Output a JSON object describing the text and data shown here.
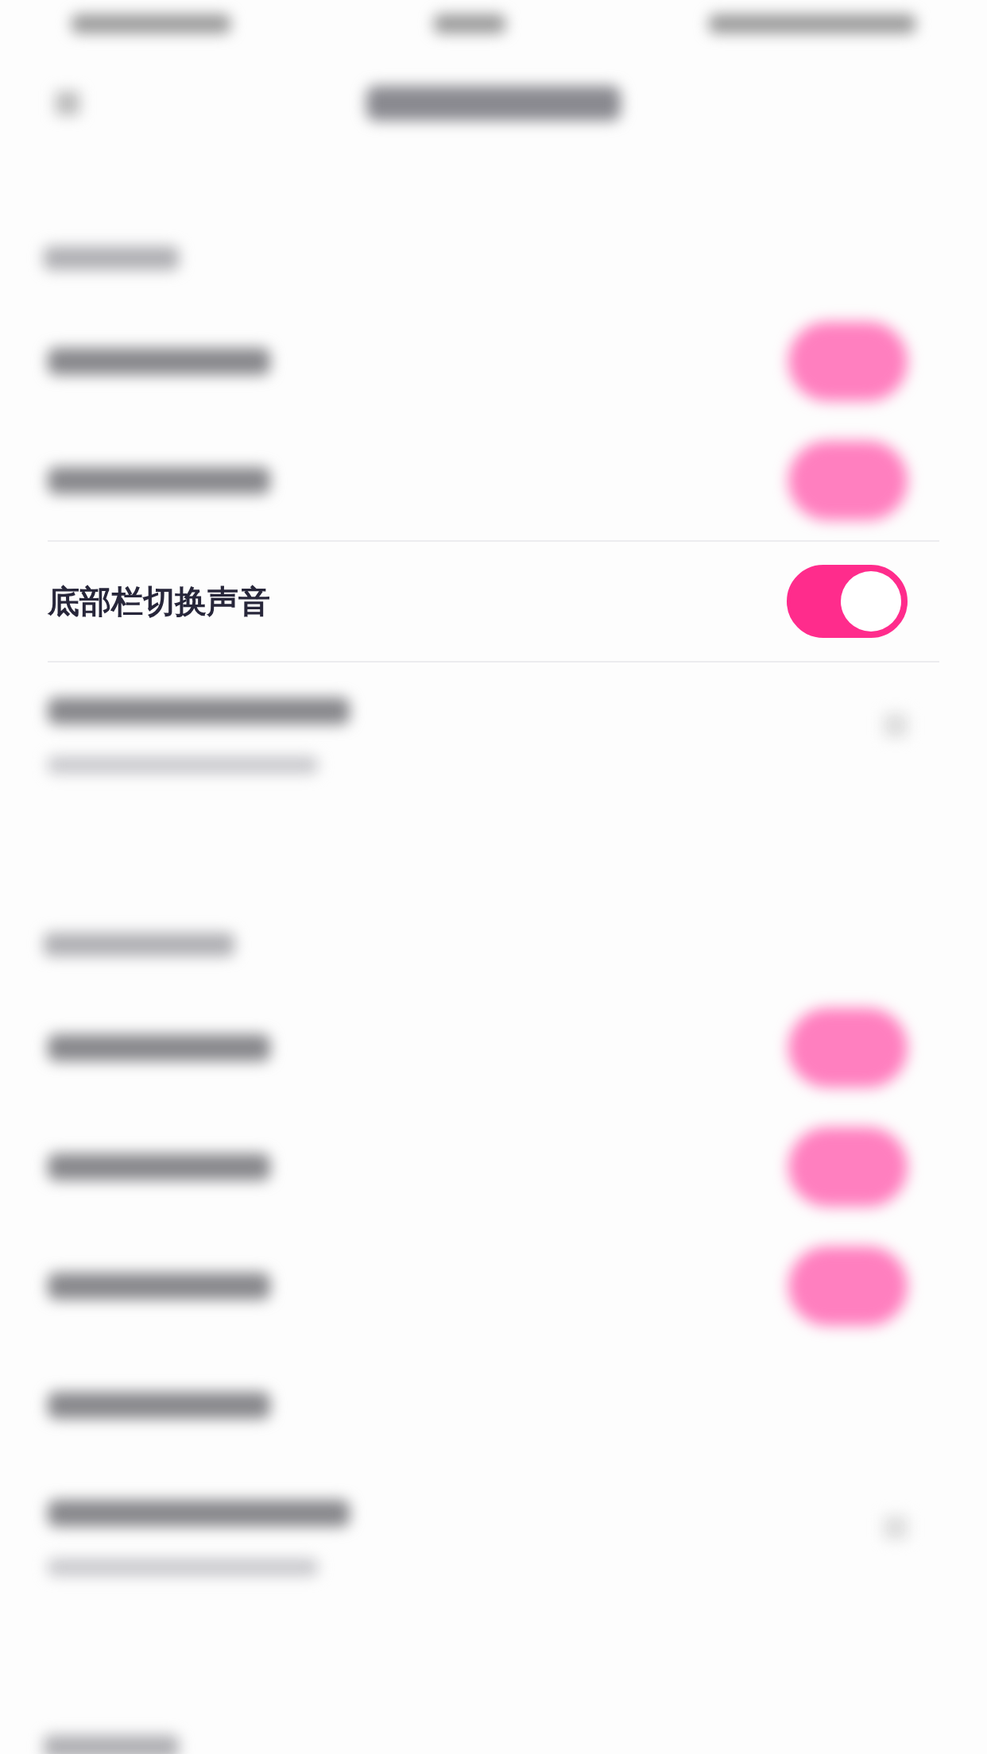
{
  "sections": [
    {
      "blurred_header": true,
      "rows": [
        {
          "kind": "toggle",
          "blurred": true,
          "on": true
        },
        {
          "kind": "toggle",
          "blurred": true,
          "on": true
        },
        {
          "kind": "toggle",
          "blurred": false,
          "label": "底部栏切换声音",
          "on": true
        },
        {
          "kind": "link",
          "blurred": true
        }
      ]
    },
    {
      "blurred_header": true,
      "rows": [
        {
          "kind": "toggle",
          "blurred": true,
          "on": true
        },
        {
          "kind": "toggle",
          "blurred": true,
          "on": true
        },
        {
          "kind": "toggle",
          "blurred": true,
          "on": true
        },
        {
          "kind": "plain",
          "blurred": true
        },
        {
          "kind": "link",
          "blurred": true
        }
      ]
    },
    {
      "blurred_header": true
    }
  ]
}
